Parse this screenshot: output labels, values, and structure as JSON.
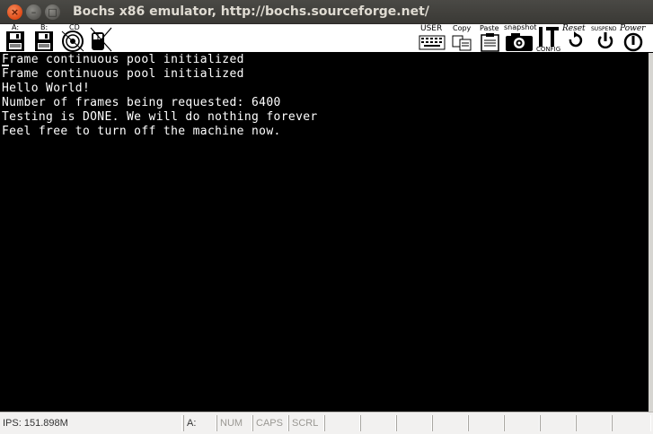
{
  "window": {
    "title": "Bochs x86 emulator, http://bochs.sourceforge.net/",
    "close_glyph": "×",
    "min_glyph": "–",
    "max_glyph": "□"
  },
  "toolbar": {
    "floppy_a_label": "A:",
    "floppy_b_label": "B:",
    "cdrom_label": "CD",
    "user_label": "USER",
    "copy_label": "Copy",
    "paste_label": "Paste",
    "snapshot_label": "snapshot",
    "config_label": "CONFIG",
    "reset_label": "Reset",
    "suspend_label": "SUSPEND",
    "power_label": "Power"
  },
  "console": {
    "lines": [
      "Frame continuous pool initialized",
      "Frame continuous pool initialized",
      "Hello World!",
      "Number of frames being requested: 6400",
      "Testing is DONE. We will do nothing forever",
      "Feel free to turn off the machine now."
    ]
  },
  "statusbar": {
    "ips": "IPS: 151.898M",
    "drive": "A:",
    "num": "NUM",
    "caps": "CAPS",
    "scrl": "SCRL"
  }
}
